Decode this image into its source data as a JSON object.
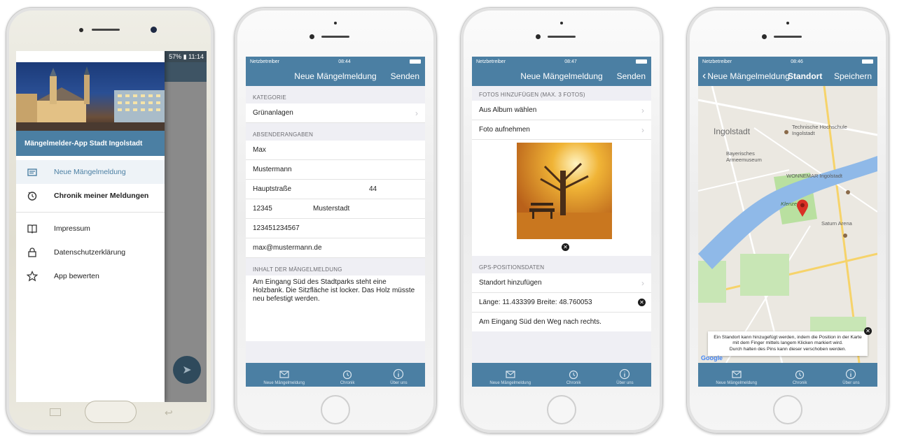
{
  "android": {
    "status_right": "57% ▮ 11:14",
    "drawer_title": "Mängelmelder-App Stadt Ingolstadt",
    "items": [
      {
        "label": "Neue Mängelmeldung",
        "icon": "report-icon"
      },
      {
        "label": "Chronik meiner Meldungen",
        "icon": "history-icon"
      },
      {
        "label": "Impressum",
        "icon": "book-icon"
      },
      {
        "label": "Datenschutzerklärung",
        "icon": "lock-icon"
      },
      {
        "label": "App bewerten",
        "icon": "star-icon"
      }
    ]
  },
  "ios_status": {
    "carrier": "Netzbetreiber",
    "time1": "08:44",
    "time2": "08:47",
    "time3": "08:46"
  },
  "screen1": {
    "nav_title": "Neue Mängelmeldung",
    "nav_right": "Senden",
    "sec_kategorie": "KATEGORIE",
    "kategorie": "Grünanlagen",
    "sec_absender": "ABSENDERANGABEN",
    "firstname": "Max",
    "lastname": "Mustermann",
    "street": "Hauptstraße",
    "housenr": "44",
    "zip": "12345",
    "city": "Musterstadt",
    "phone": "123451234567",
    "email": "max@mustermann.de",
    "sec_inhalt": "INHALT DER MÄNGELMELDUNG",
    "text": "Am Eingang Süd des Stadtparks steht eine Holzbank. Die Sitzfläche ist locker. Das Holz müsste neu befestigt werden."
  },
  "screen2": {
    "nav_title": "Neue Mängelmeldung",
    "nav_right": "Senden",
    "sec_fotos": "FOTOS HINZUFÜGEN (MAX. 3 FOTOS)",
    "album": "Aus Album wählen",
    "foto": "Foto aufnehmen",
    "sec_gps": "GPS-POSITIONSDATEN",
    "standort": "Standort hinzufügen",
    "coords": "Länge: 11.433399 Breite: 48.760053",
    "desc": "Am Eingang Süd den Weg nach rechts."
  },
  "screen3": {
    "back": "Neue Mängelmeldung",
    "nav_title": "Standort",
    "nav_right": "Speichern",
    "map_labels": [
      "Ingolstadt",
      "Technische Hochschule Ingolstadt",
      "Bayerisches Armeemuseum",
      "WONNEMAR Ingolstadt",
      "Klenzepark",
      "Saturn Arena"
    ],
    "tooltip_1": "Ein Standort kann hinzugefügt werden, indem die Position in der Karte mit dem Finger mittels langem Klicken markiert wird.",
    "tooltip_2": "Durch halten des Pins kann dieser verschoben werden.",
    "google": "Google"
  },
  "tabs": {
    "t1": "Neue Mängelmeldung",
    "t2": "Chronik",
    "t3": "Über uns"
  },
  "colors": {
    "accent": "#4b7fa3",
    "pin": "#d93025"
  }
}
